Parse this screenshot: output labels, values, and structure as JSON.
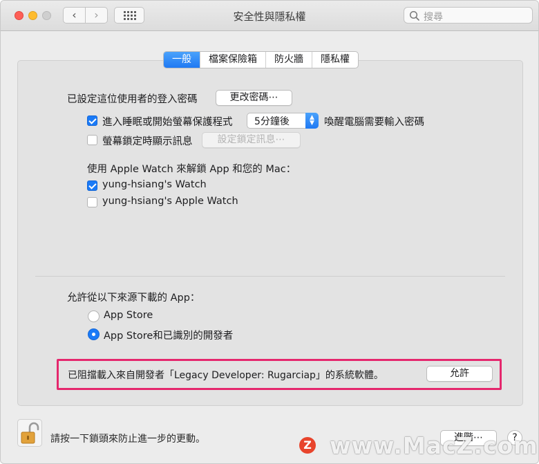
{
  "window": {
    "title": "安全性與隱私權"
  },
  "toolbar": {
    "back_icon": "chevron-left-icon",
    "forward_icon": "chevron-right-icon",
    "grid_icon": "grid-icon",
    "search_placeholder": "搜尋"
  },
  "tabs": [
    {
      "label": "一般",
      "active": true
    },
    {
      "label": "檔案保險箱",
      "active": false
    },
    {
      "label": "防火牆",
      "active": false
    },
    {
      "label": "隱私權",
      "active": false
    }
  ],
  "general": {
    "password_label": "已設定這位使用者的登入密碼",
    "change_password_button": "更改密碼⋯",
    "require_password": {
      "label": "進入睡眠或開始螢幕保護程式",
      "checked": true
    },
    "delay_value": "5分鐘後",
    "require_password_suffix": "喚醒電腦需要輸入密碼",
    "show_message": {
      "label": "螢幕鎖定時顯示訊息",
      "checked": false
    },
    "set_lock_message_button": "設定鎖定訊息⋯",
    "apple_watch_label": "使用 Apple Watch 來解鎖 App 和您的 Mac：",
    "watches": [
      {
        "label": "yung-hsiang's Watch",
        "checked": true
      },
      {
        "label": "yung-hsiang's Apple Watch",
        "checked": false
      }
    ]
  },
  "downloads": {
    "label": "允許從以下來源下載的 App：",
    "options": [
      {
        "label": "App Store",
        "selected": false
      },
      {
        "label": "App Store和已識別的開發者",
        "selected": true
      }
    ],
    "blocked_message": "已阻擋載入來自開發者「Legacy Developer: Rugarciap」的系統軟體。",
    "allow_button": "允許"
  },
  "footer": {
    "lock_message": "請按一下鎖頭來防止進一步的更動。",
    "advanced_button": "進階⋯",
    "help_button": "?",
    "lock_icon": "unlocked-padlock-icon"
  },
  "watermark": {
    "logo": "Z",
    "text": "www.MacZ.com"
  },
  "colors": {
    "accent": "#1a7af7",
    "highlight": "#e5276d"
  }
}
